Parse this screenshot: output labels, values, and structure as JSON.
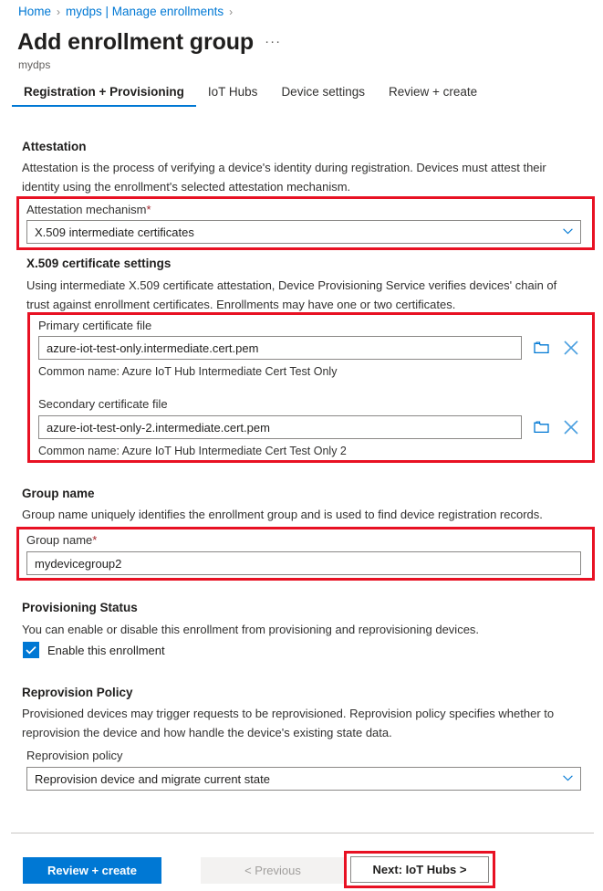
{
  "breadcrumb": {
    "items": [
      {
        "label": "Home"
      },
      {
        "label": "mydps | Manage enrollments"
      }
    ],
    "separator": "›"
  },
  "header": {
    "title": "Add enrollment group",
    "ellipsis": "···",
    "subtitle": "mydps"
  },
  "tabs": [
    {
      "label": "Registration + Provisioning",
      "active": true
    },
    {
      "label": "IoT Hubs",
      "active": false
    },
    {
      "label": "Device settings",
      "active": false
    },
    {
      "label": "Review + create",
      "active": false
    }
  ],
  "attestation": {
    "heading": "Attestation",
    "description": "Attestation is the process of verifying a device's identity during registration. Devices must attest their identity using the enrollment's selected attestation mechanism.",
    "mechanism_label": "Attestation mechanism",
    "required_mark": "*",
    "mechanism_value": "X.509 intermediate certificates",
    "chevron": "∨"
  },
  "x509": {
    "heading": "X.509 certificate settings",
    "description": "Using intermediate X.509 certificate attestation, Device Provisioning Service verifies devices' chain of trust against enrollment certificates. Enrollments may have one or two certificates.",
    "primary_label": "Primary certificate file",
    "primary_value": "azure-iot-test-only.intermediate.cert.pem",
    "primary_common_name": "Common name: Azure IoT Hub Intermediate Cert Test Only",
    "secondary_label": "Secondary certificate file",
    "secondary_value": "azure-iot-test-only-2.intermediate.cert.pem",
    "secondary_common_name": "Common name: Azure IoT Hub Intermediate Cert Test Only 2"
  },
  "group_name": {
    "heading": "Group name",
    "description": "Group name uniquely identifies the enrollment group and is used to find device registration records.",
    "field_label": "Group name",
    "required_mark": "*",
    "value": "mydevicegroup2"
  },
  "provisioning_status": {
    "heading": "Provisioning Status",
    "description": "You can enable or disable this enrollment from provisioning and reprovisioning devices.",
    "checkbox_label": "Enable this enrollment",
    "checked": true
  },
  "reprovision_policy": {
    "heading": "Reprovision Policy",
    "description": "Provisioned devices may trigger requests to be reprovisioned. Reprovision policy specifies whether to reprovision the device and how handle the device's existing state data.",
    "field_label": "Reprovision policy",
    "value": "Reprovision device and migrate current state",
    "chevron": "∨"
  },
  "footer": {
    "review_create": "Review + create",
    "previous": "< Previous",
    "next": "Next: IoT Hubs >"
  },
  "colors": {
    "accent": "#0078d4",
    "highlight": "#e81123",
    "required": "#a4262c",
    "text": "#201f1e",
    "muted": "#605e5c"
  }
}
